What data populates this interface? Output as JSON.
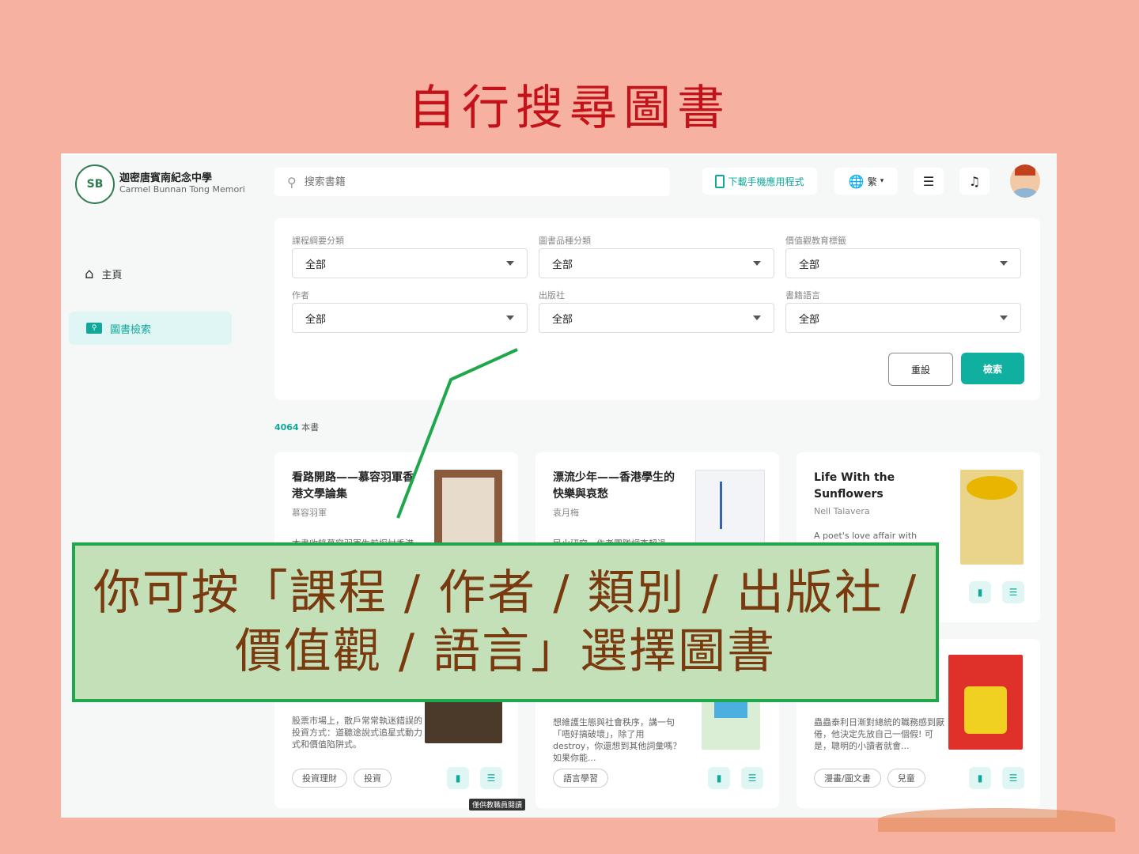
{
  "slide": {
    "title": "自行搜尋圖書",
    "callout_line1": "你可按「課程 / 作者 / 類別 / 出版社 /",
    "callout_line2": "價值觀 / 語言」選擇圖書"
  },
  "colors": {
    "accent": "#10b0a0",
    "slide_bg": "#f6b1a0",
    "title": "#c4121a",
    "callout_bg": "#c4e0b8",
    "callout_border": "#1fa84b"
  },
  "header": {
    "school_name": "迦密唐賓南紀念中學",
    "school_en": "Carmel Bunnan Tong Memori...",
    "logo_text": "SB",
    "search_placeholder": "搜索書籍",
    "download_label": "下載手機應用程式",
    "lang_label": "繁",
    "icons": [
      "search-icon",
      "phone-icon",
      "globe-icon",
      "menu-icon",
      "bell-icon"
    ]
  },
  "sidebar": {
    "home_label": "主頁",
    "search_label": "圖書檢索"
  },
  "filters": {
    "curriculum_label": "課程綱要分類",
    "genre_label": "圖書品種分類",
    "values_label": "價值觀教育標籤",
    "author_label": "作者",
    "publisher_label": "出版社",
    "language_label": "書籍語言",
    "option_all": "全部",
    "reset_label": "重設",
    "search_label": "檢索"
  },
  "results": {
    "count": "4064",
    "count_suffix": "本書"
  },
  "books": [
    {
      "title": "看路開路——慕容羽軍香港文學論集",
      "author": "慕容羽軍",
      "desc": "本書收錄慕容羽軍生前探討香港"
    },
    {
      "title": "漂流少年——香港學生的快樂與哀愁",
      "author": "袁月梅",
      "desc": "民火研究，作者團隊調查超過一"
    },
    {
      "title": "Life With the Sunflowers",
      "author": "Nell Talavera",
      "desc": "A poet's love affair with words is"
    },
    {
      "title": "",
      "author": "",
      "desc": "股票市場上，散戶常常執迷錯誤的投資方式：道聽途說式追星式動力式和價值陷阱式。",
      "tags": [
        "投資理財",
        "投資"
      ],
      "badge": "僅供教職員閱讀"
    },
    {
      "title": "",
      "author": "",
      "desc": "想維護生態與社會秩序，講一句「唔好搞破壞」，除了用destroy，你還想到其他詞彙嗎？如果你能...",
      "tags": [
        "語言學習"
      ]
    },
    {
      "title": "",
      "author": "",
      "desc": "蟲蟲泰利日漸對總統的職務感到厭倦，他決定先放自己一個假! 可是，聰明的小讀者就會...",
      "tags": [
        "漫畫/圖文書",
        "兒童"
      ]
    }
  ]
}
